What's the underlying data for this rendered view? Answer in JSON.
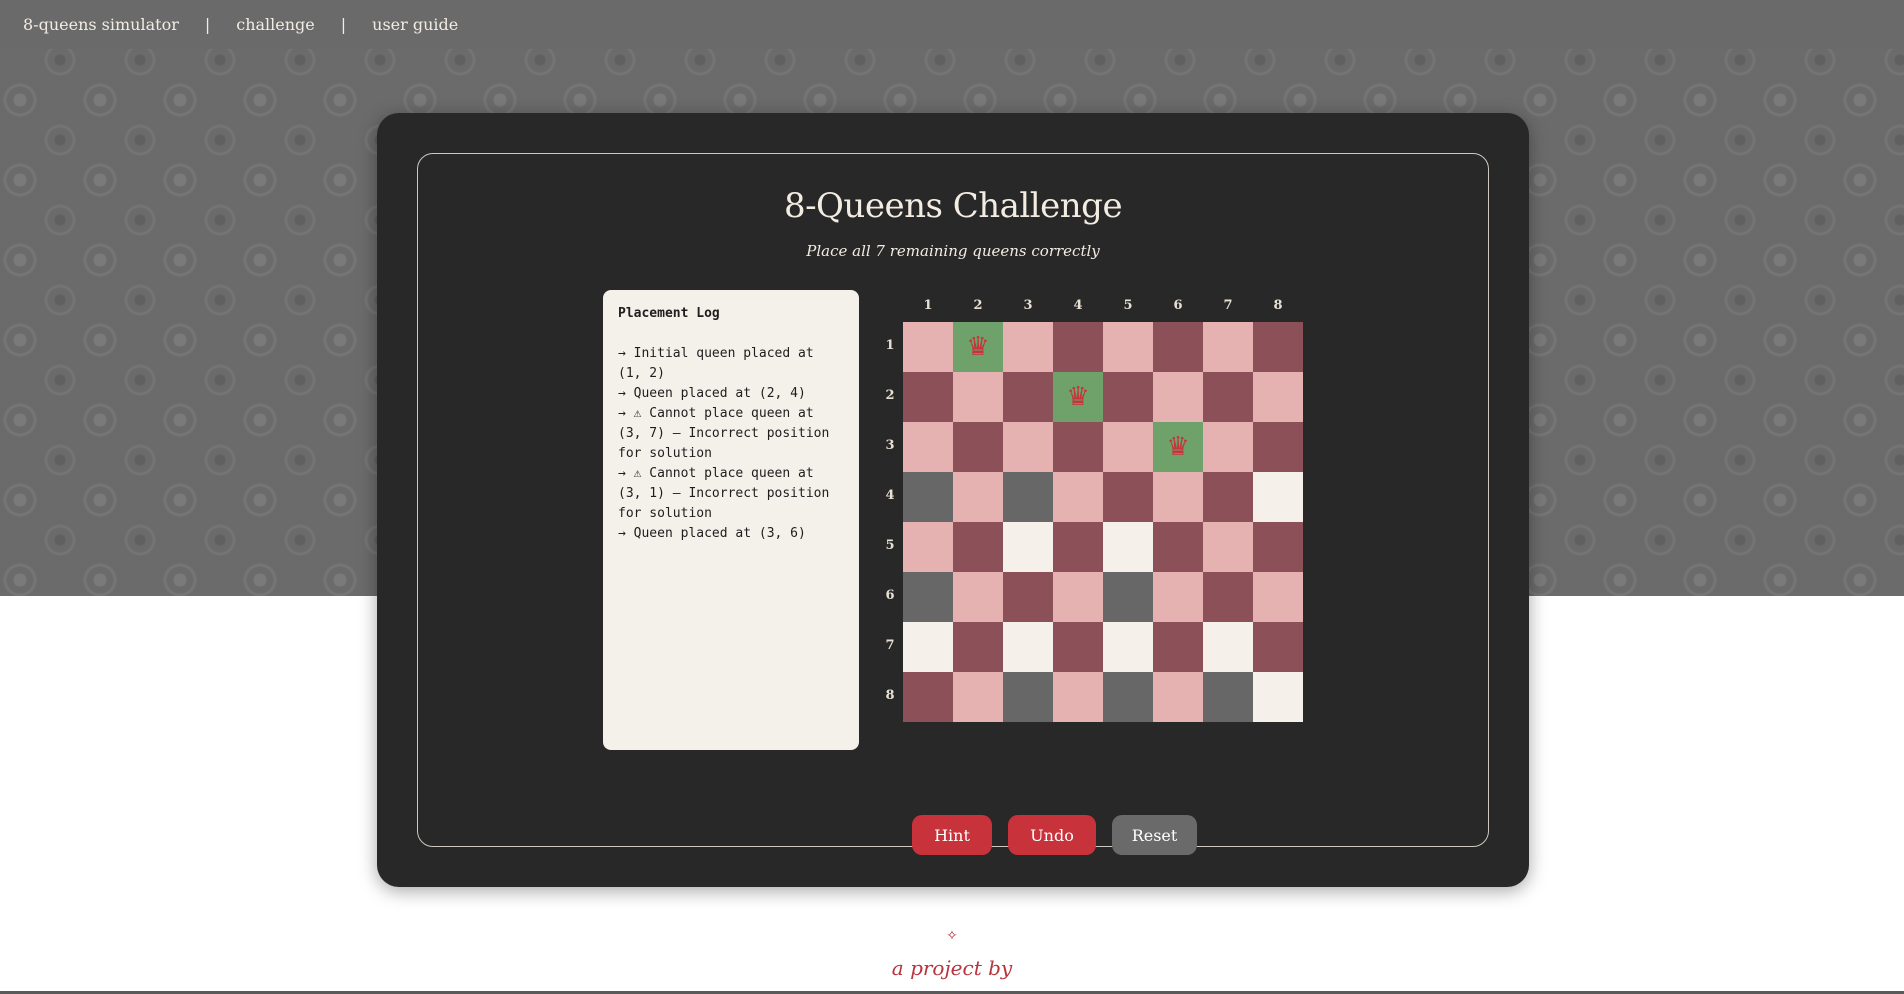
{
  "nav": {
    "items": [
      "8-queens simulator",
      "challenge",
      "user guide"
    ],
    "separator": "|"
  },
  "challenge": {
    "title": "8-Queens Challenge",
    "subtitle": "Place all 7 remaining queens correctly"
  },
  "log": {
    "title": "Placement Log",
    "entries": [
      "→ Initial queen placed at (1, 2)",
      "→ Queen placed at (2, 4)",
      "→ ⚠ Cannot place queen at (3, 7) — Incorrect position for solution",
      "→ ⚠ Cannot place queen at (3, 1) — Incorrect position for solution",
      "→ Queen placed at (3, 6)"
    ]
  },
  "board": {
    "column_labels": [
      "1",
      "2",
      "3",
      "4",
      "5",
      "6",
      "7",
      "8"
    ],
    "row_labels": [
      "1",
      "2",
      "3",
      "4",
      "5",
      "6",
      "7",
      "8"
    ],
    "queen_icon": "queen-icon",
    "queen_symbol": "♛",
    "colors": {
      "L": "#e6b1b1",
      "D": "#8c5058",
      "G": "#676767",
      "W": "#f5f0e9",
      "Q": "#6fa26b"
    },
    "queens": [
      {
        "row": 1,
        "col": 2
      },
      {
        "row": 2,
        "col": 4
      },
      {
        "row": 3,
        "col": 6
      }
    ],
    "cells": [
      [
        "L",
        "Q",
        "L",
        "D",
        "L",
        "D",
        "L",
        "D"
      ],
      [
        "D",
        "L",
        "D",
        "Q",
        "D",
        "L",
        "D",
        "L"
      ],
      [
        "L",
        "D",
        "L",
        "D",
        "L",
        "Q",
        "L",
        "D"
      ],
      [
        "G",
        "L",
        "G",
        "L",
        "D",
        "L",
        "D",
        "W"
      ],
      [
        "L",
        "D",
        "W",
        "D",
        "W",
        "D",
        "L",
        "D"
      ],
      [
        "G",
        "L",
        "D",
        "L",
        "G",
        "L",
        "D",
        "L"
      ],
      [
        "W",
        "D",
        "W",
        "D",
        "W",
        "D",
        "W",
        "D"
      ],
      [
        "D",
        "L",
        "G",
        "L",
        "G",
        "L",
        "G",
        "W"
      ]
    ]
  },
  "buttons": {
    "hint": "Hint",
    "undo": "Undo",
    "reset": "Reset",
    "colors": {
      "primary": "#c8323a",
      "secondary": "#6a6a6a"
    }
  },
  "footer": {
    "mark": "✧",
    "text": "a project by"
  }
}
